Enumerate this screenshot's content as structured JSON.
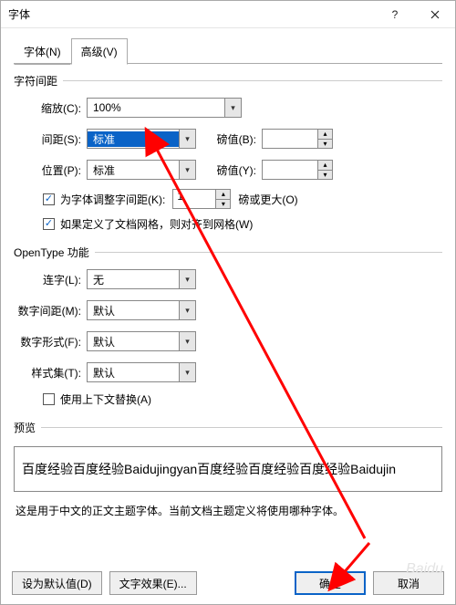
{
  "window": {
    "title": "字体"
  },
  "tabs": {
    "font": "字体(N)",
    "advanced": "高级(V)"
  },
  "charSpacing": {
    "title": "字符间距",
    "scale": {
      "label": "缩放(C):",
      "value": "100%"
    },
    "spacing": {
      "label": "间距(S):",
      "value": "标准",
      "ptlabel": "磅值(B):",
      "ptvalue": ""
    },
    "position": {
      "label": "位置(P):",
      "value": "标准",
      "ptlabel": "磅值(Y):",
      "ptvalue": ""
    },
    "kerning": {
      "label": "为字体调整字间距(K):",
      "value": "1",
      "unit": "磅或更大(O)",
      "checked": "✓"
    },
    "grid": {
      "label": "如果定义了文档网格，则对齐到网格(W)",
      "checked": "✓"
    }
  },
  "opentype": {
    "title": "OpenType 功能",
    "ligature": {
      "label": "连字(L):",
      "value": "无"
    },
    "numSpacing": {
      "label": "数字间距(M):",
      "value": "默认"
    },
    "numForm": {
      "label": "数字形式(F):",
      "value": "默认"
    },
    "styleSet": {
      "label": "样式集(T):",
      "value": "默认"
    },
    "contextual": {
      "label": "使用上下文替换(A)",
      "checked": ""
    }
  },
  "preview": {
    "title": "预览",
    "text": "百度经验百度经验Baidujingyan百度经验百度经验百度经验Baidujin",
    "note": "这是用于中文的正文主题字体。当前文档主题定义将使用哪种字体。"
  },
  "buttons": {
    "setDefault": "设为默认值(D)",
    "textEffects": "文字效果(E)...",
    "ok": "确定",
    "cancel": "取消"
  },
  "watermark": "Baidu"
}
